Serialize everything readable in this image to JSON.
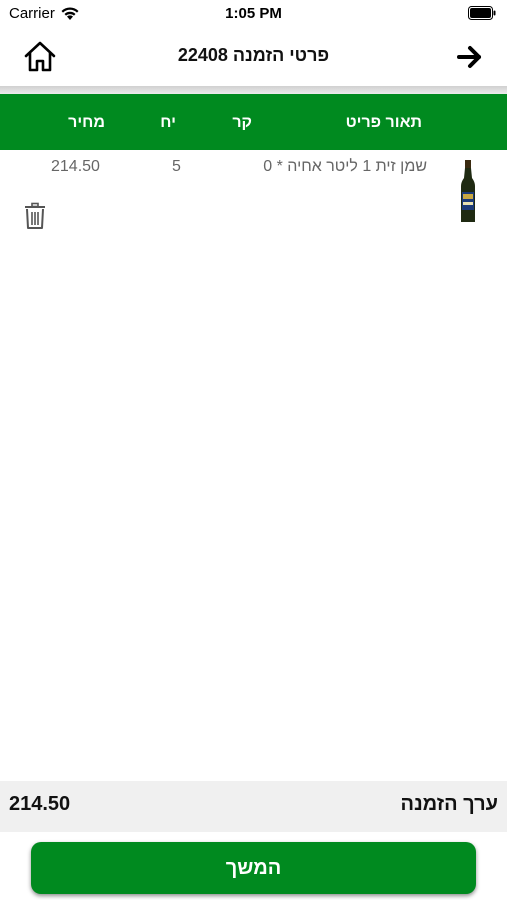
{
  "status_bar": {
    "carrier": "Carrier",
    "time": "1:05 PM"
  },
  "header": {
    "title": "פרטי הזמנה 22408",
    "home_icon": "home-icon",
    "back_icon": "arrow-right-icon"
  },
  "table": {
    "columns": {
      "description": "תאור פריט",
      "kr": "קר",
      "units": "יח",
      "price": "מחיר"
    },
    "rows": [
      {
        "description": "שמן זית 1 ליטר אחיה * 0",
        "units": "5",
        "price": "214.50",
        "image_icon": "olive-oil-bottle-image",
        "delete_icon": "trash-icon"
      }
    ]
  },
  "total": {
    "label": "ערך הזמנה",
    "value": "214.50"
  },
  "continue_button": {
    "label": "המשך"
  },
  "colors": {
    "accent_green": "#008a1f",
    "total_bar_bg": "#f0f0f0",
    "cell_text": "#666666"
  }
}
